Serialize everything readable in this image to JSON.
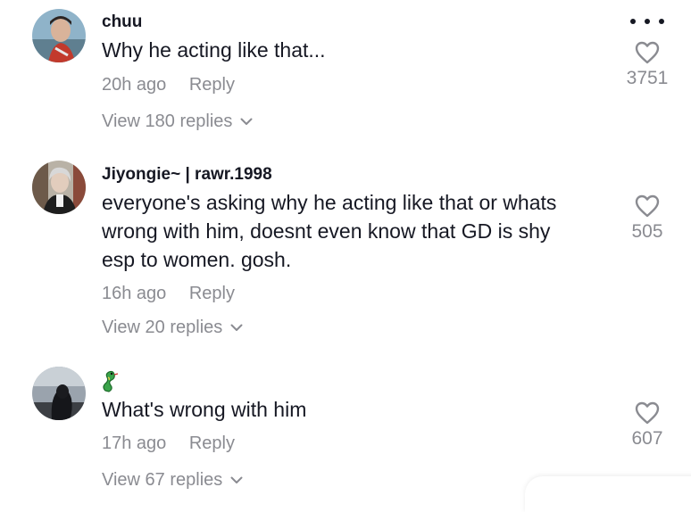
{
  "comments": [
    {
      "username": "chuu",
      "text": [
        "Why he acting like that..."
      ],
      "time": "20h ago",
      "reply_label": "Reply",
      "view_replies": "View 180 replies",
      "likes": "3751",
      "avatar_icon": "avatar-photo"
    },
    {
      "username": "Jiyongie~ | rawr.1998",
      "text": [
        "everyone's asking why he acting like that or whats",
        "wrong with him, doesnt even know that GD is shy",
        "esp to women. gosh."
      ],
      "time": "16h ago",
      "reply_label": "Reply",
      "view_replies": "View 20 replies",
      "likes": "505",
      "avatar_icon": "avatar-photo"
    },
    {
      "username": "",
      "text": [
        "What's wrong with him"
      ],
      "time": "17h ago",
      "reply_label": "Reply",
      "view_replies": "View 67 replies",
      "likes": "607",
      "avatar_icon": "avatar-photo",
      "badge_icon": "snake-emoji-icon"
    }
  ],
  "icons": {
    "more": "more-options-icon",
    "like": "heart-icon",
    "expand": "chevron-down-icon"
  },
  "colors": {
    "text_primary": "#161823",
    "text_secondary": "#8a8b91"
  }
}
